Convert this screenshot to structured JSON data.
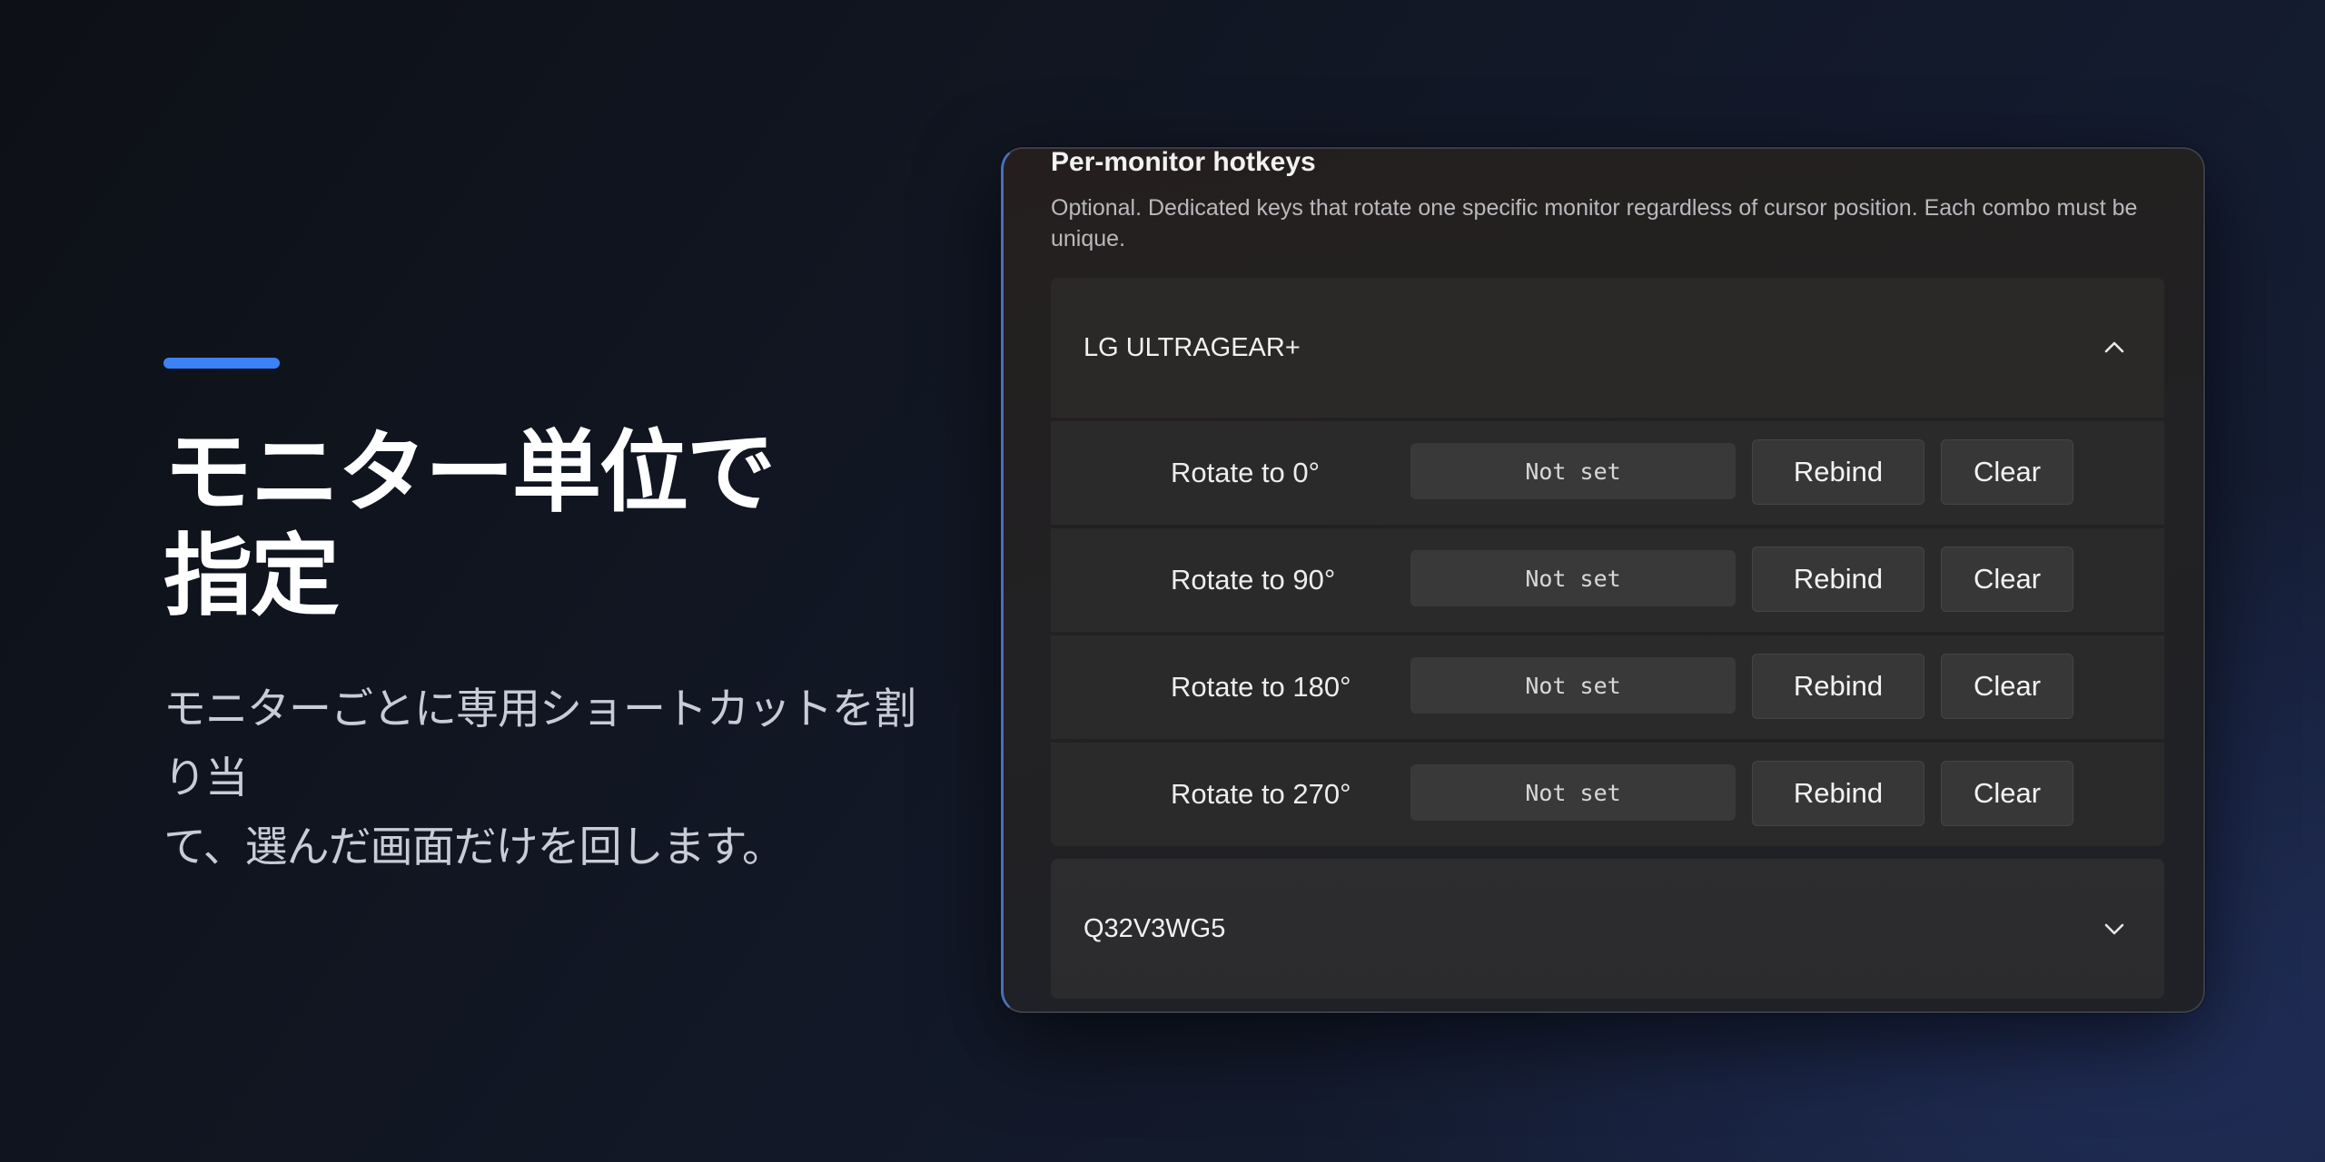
{
  "hero": {
    "title_line1": "モニター単位で",
    "title_line2": "指定",
    "subtitle_line1": "モニターごとに専用ショートカットを割り当",
    "subtitle_line2": "て、選んだ画面だけを回します。"
  },
  "panel": {
    "title": "Per-monitor hotkeys",
    "description": "Optional. Dedicated keys that rotate one specific monitor regardless of cursor position. Each combo must be unique."
  },
  "monitors": [
    {
      "name": "LG ULTRAGEAR+",
      "expanded": true,
      "chevron": "chevron-up-icon",
      "rows": [
        {
          "label": "Rotate to 0°",
          "value": "Not set",
          "rebind": "Rebind",
          "clear": "Clear"
        },
        {
          "label": "Rotate to 90°",
          "value": "Not set",
          "rebind": "Rebind",
          "clear": "Clear"
        },
        {
          "label": "Rotate to 180°",
          "value": "Not set",
          "rebind": "Rebind",
          "clear": "Clear"
        },
        {
          "label": "Rotate to 270°",
          "value": "Not set",
          "rebind": "Rebind",
          "clear": "Clear"
        }
      ]
    },
    {
      "name": "Q32V3WG5",
      "expanded": false,
      "chevron": "chevron-down-icon"
    }
  ],
  "colors": {
    "accent": "#3b82f6",
    "window_border_accent": "#4b6fb8"
  }
}
